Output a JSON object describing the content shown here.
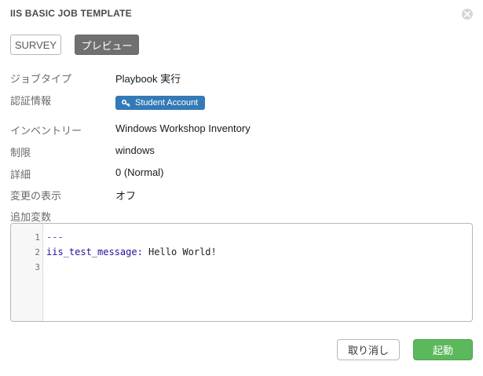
{
  "modal": {
    "title": "IIS BASIC JOB TEMPLATE",
    "close_icon": "close-icon"
  },
  "tabs": {
    "survey": "SURVEY",
    "preview": "プレビュー"
  },
  "details": {
    "job_type_label": "ジョブタイプ",
    "job_type_value": "Playbook 実行",
    "credential_label": "認証情報",
    "credential_value": "Student Account",
    "credential_icon": "key-icon",
    "inventory_label": "インベントリー",
    "inventory_value": "Windows Workshop Inventory",
    "limit_label": "制限",
    "limit_value": "windows",
    "verbosity_label": "詳細",
    "verbosity_value": "0 (Normal)",
    "show_changes_label": "変更の表示",
    "show_changes_value": "オフ"
  },
  "extra_vars": {
    "label": "追加変数",
    "line_numbers": [
      "1",
      "2",
      "3"
    ],
    "line1": "---",
    "line2_key": "iis_test_message:",
    "line2_value": " Hello World!"
  },
  "footer": {
    "cancel": "取り消し",
    "launch": "起動"
  },
  "colors": {
    "credential_badge": "#337ab7",
    "launch_button": "#5cb85c",
    "preview_tab": "#707070"
  }
}
